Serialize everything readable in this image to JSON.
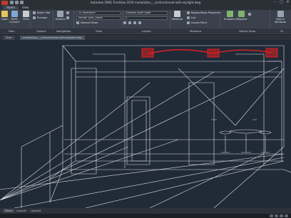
{
  "window": {
    "title": "Autodesk DWG TrueView 2016   modulation_-_(entrustimnet-with-skylight.dwg",
    "minimize": "–",
    "maximize": "□",
    "close": "✕"
  },
  "ribbon_tabs": [
    "Home",
    "View"
  ],
  "ribbon": {
    "open": "Open",
    "dwg_convert": "DWG Convert",
    "print": "Print",
    "batch_plot": "Batch Plot",
    "preview": "Preview",
    "extents": "Extents",
    "visual_style": "2D Wireframe",
    "view_combo": "Render View_20fpm",
    "named_views": "Named Views",
    "layer_state": "Unsaved Layer State",
    "layer_combo": "0",
    "measure": "Measure",
    "region_mass": "Region/Mass Properties",
    "list": "List",
    "locate_point": "Locate Point",
    "endpoint": "Endpoint",
    "midpoint": "Midpoint",
    "switch_windows": "Switch Windows"
  },
  "ribbon_groups": [
    "Files",
    "Output",
    "Navigation",
    "View",
    "Layers",
    "Measure",
    "Object Snap",
    "UI"
  ],
  "drawing_tabs": [
    "Start",
    "modulation_-_(entrustimnet-with-skylight.dwg"
  ],
  "layout_tabs": [
    "Model",
    "Layout1",
    "Layout2"
  ],
  "colors": {
    "viewport_bg": "#212b38",
    "wireframe": "#d9dde2",
    "highlight": "#e02020"
  }
}
